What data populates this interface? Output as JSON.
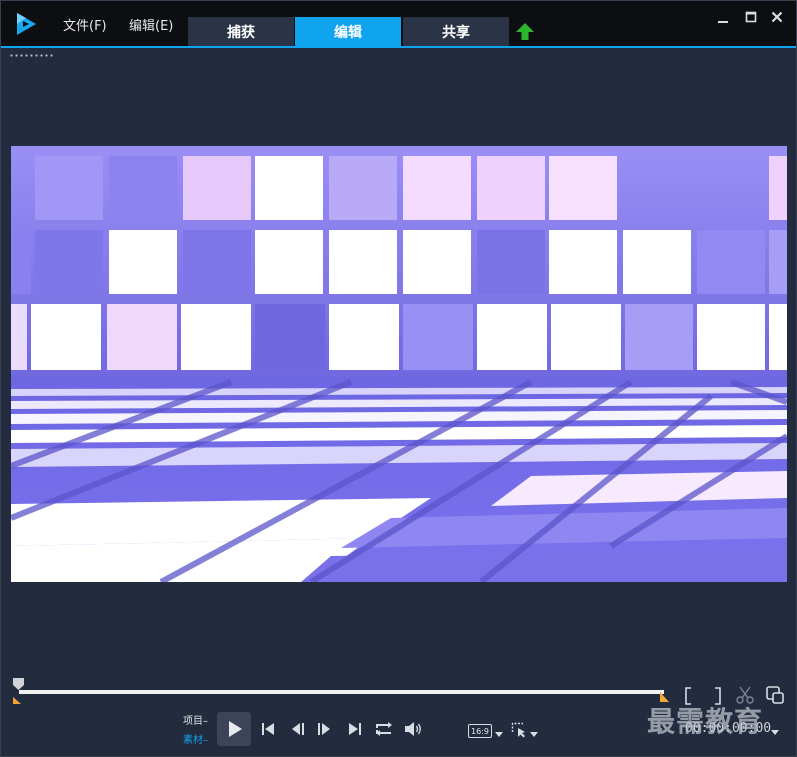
{
  "menu": {
    "file": "文件(F)",
    "edit": "编辑(E)"
  },
  "tabs": {
    "capture": "捕获",
    "edit": "编辑",
    "share": "共享"
  },
  "preview_controls": {
    "project_label": "项目",
    "clip_label": "素材",
    "aspect_ratio": "16:9",
    "timecode": "00:00:00:00"
  },
  "watermark": "最需教育",
  "colors": {
    "accent": "#11a4ee",
    "upload": "#2db52d",
    "preview_bg": "#7c74ee"
  }
}
